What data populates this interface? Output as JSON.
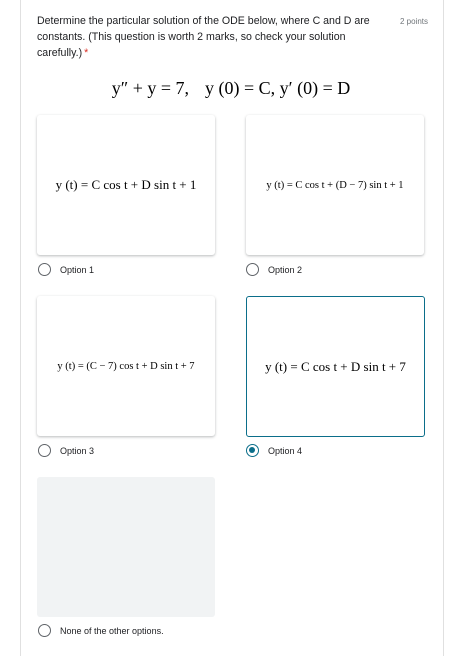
{
  "question": {
    "text": "Determine the particular solution of the ODE below, where C and D are constants. (This question is worth 2 marks, so check your solution carefully.)",
    "required_marker": "*",
    "points": "2 points",
    "equation_left": "y″ + y = 7,",
    "equation_right": "y (0) = C,  y′ (0) = D"
  },
  "options": [
    {
      "label": "Option 1",
      "formula": "y (t) = C cos t + D sin t + 1",
      "checked": false
    },
    {
      "label": "Option 2",
      "formula": "y (t) = C cos t + (D − 7) sin t + 1",
      "checked": false
    },
    {
      "label": "Option 3",
      "formula": "y (t) = (C − 7) cos t + D sin t + 7",
      "checked": false
    },
    {
      "label": "Option 4",
      "formula": "y (t) = C cos t + D sin t + 7",
      "checked": true
    },
    {
      "label": "None of the other options.",
      "formula": "",
      "checked": false
    }
  ],
  "colors": {
    "accent": "#0b6e8a",
    "required": "#d93025",
    "placeholder_bg": "#f1f3f4"
  }
}
